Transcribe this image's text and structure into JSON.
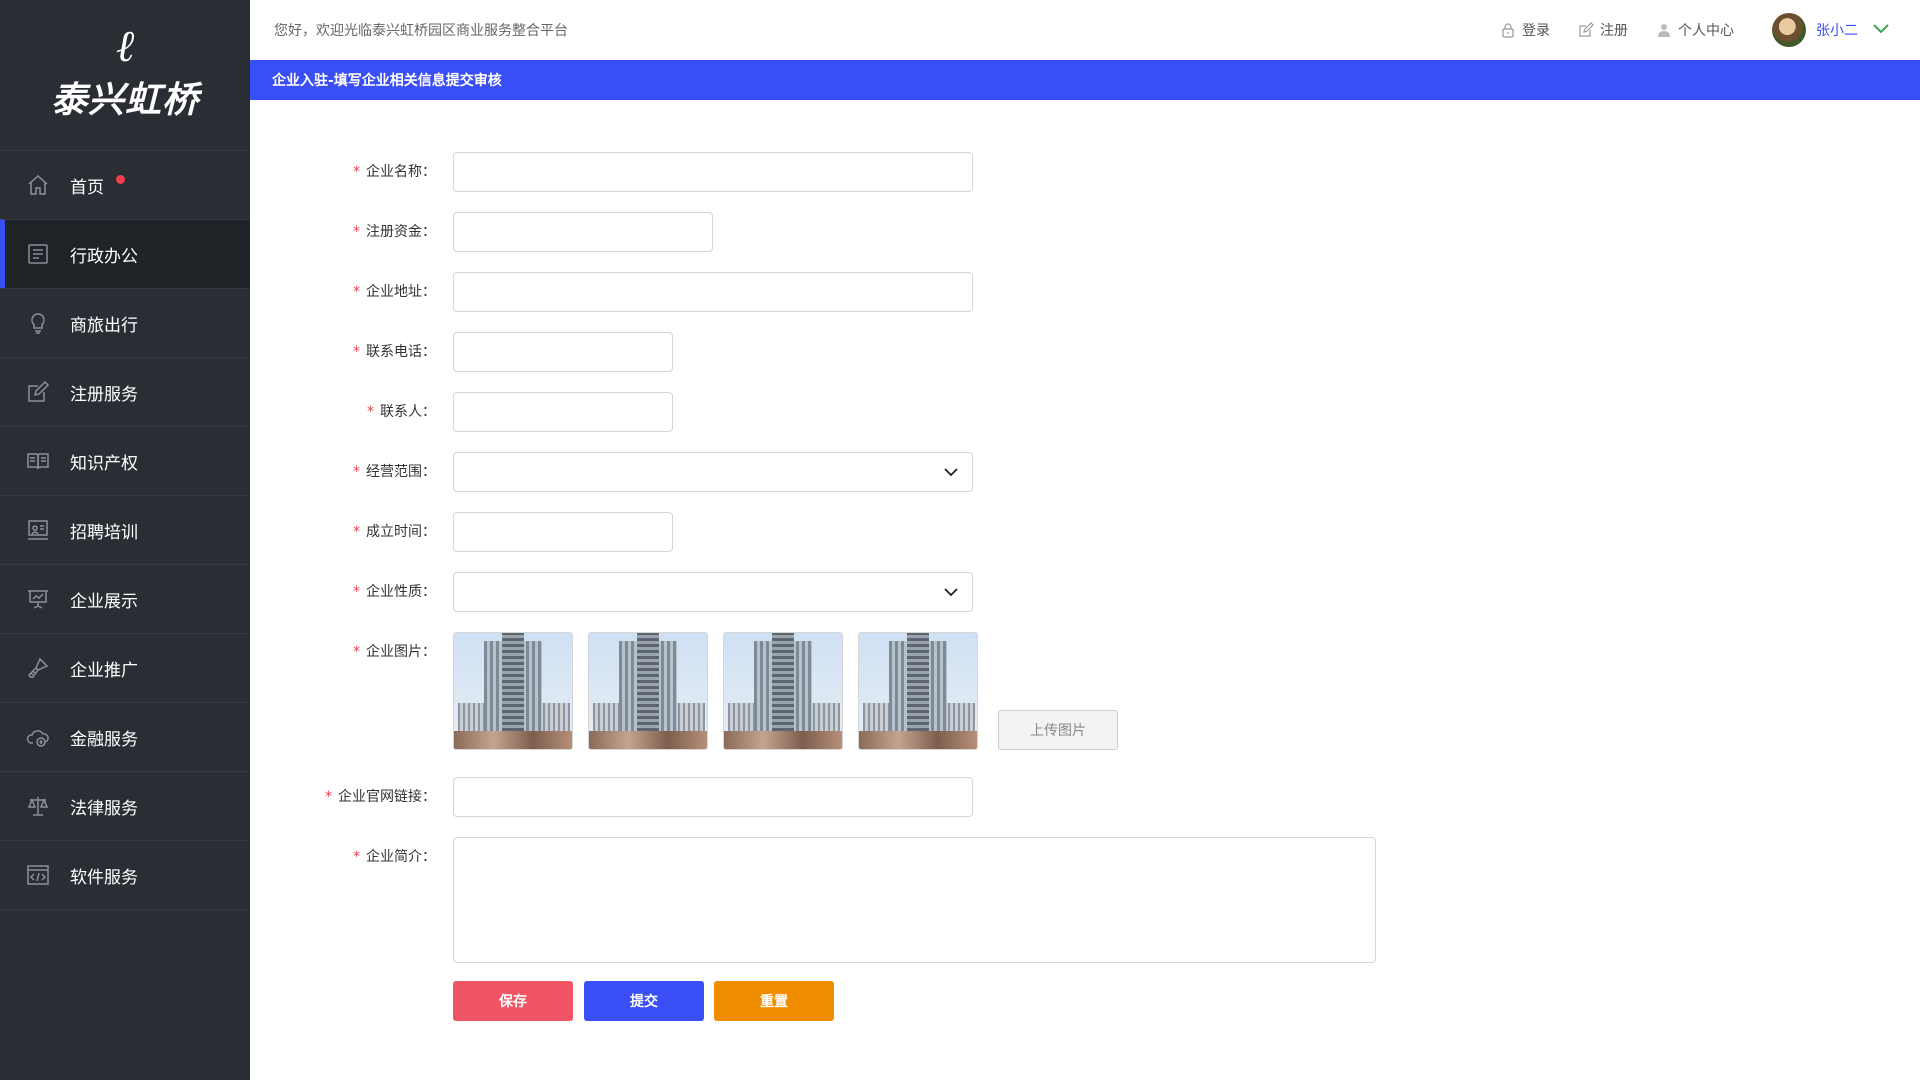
{
  "sidebar": {
    "logo_mark": "ℓ",
    "logo_text": "泰兴虹桥",
    "items": [
      {
        "label": "首页",
        "icon": "home-icon",
        "badge": "red-dot"
      },
      {
        "label": "行政办公",
        "icon": "document-icon",
        "active": true
      },
      {
        "label": "商旅出行",
        "icon": "lightbulb-icon"
      },
      {
        "label": "注册服务",
        "icon": "edit-icon"
      },
      {
        "label": "知识产权",
        "icon": "book-icon"
      },
      {
        "label": "招聘培训",
        "icon": "presentation-icon"
      },
      {
        "label": "企业展示",
        "icon": "display-board-icon"
      },
      {
        "label": "企业推广",
        "icon": "brush-icon"
      },
      {
        "label": "金融服务",
        "icon": "cloud-finance-icon"
      },
      {
        "label": "法律服务",
        "icon": "scale-icon"
      },
      {
        "label": "软件服务",
        "icon": "code-window-icon"
      }
    ]
  },
  "header": {
    "welcome": "您好，欢迎光临泰兴虹桥园区商业服务整合平台",
    "login": "登录",
    "register": "注册",
    "profile": "个人中心",
    "username": "张小二"
  },
  "banner": {
    "title": "企业入驻-填写企业相关信息提交审核"
  },
  "form": {
    "required_mark": "*",
    "company_name": "企业名称：",
    "registered_capital": "注册资金：",
    "company_address": "企业地址：",
    "phone": "联系电话：",
    "contact": "联系人：",
    "business_scope": "经营范围：",
    "established": "成立时间：",
    "company_type": "企业性质：",
    "images": "企业图片：",
    "upload_label": "上传图片",
    "website": "企业官网链接：",
    "intro": "企业简介："
  },
  "buttons": {
    "save": "保存",
    "submit": "提交",
    "reset": "重置"
  },
  "colors": {
    "accent": "#3a4ef5",
    "sidebar_bg": "#2a2e34",
    "save": "#ef5563",
    "submit": "#3a4ef5",
    "reset": "#f08c00",
    "required": "#f0404f"
  }
}
